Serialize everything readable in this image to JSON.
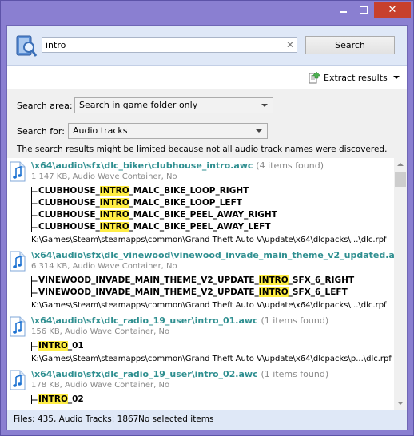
{
  "search": {
    "value": "intro",
    "clear_glyph": "✕",
    "button_label": "Search"
  },
  "toolbar": {
    "extract_label": "Extract results"
  },
  "form": {
    "area_label": "Search area:",
    "area_value": "Search in game folder only",
    "for_label": "Search for:",
    "for_value": "Audio tracks",
    "notice": "The search results might be limited because not all audio track names were discovered."
  },
  "results": [
    {
      "path": "\\x64\\audio\\sfx\\dlc_biker\\clubhouse_intro.awc",
      "count": "(4 items found)",
      "meta": "1 147 KB, Audio Wave Container, No",
      "tracks": [
        {
          "pre": "CLUBHOUSE_",
          "match": "INTRO",
          "post": "_MALC_BIKE_LOOP_RIGHT"
        },
        {
          "pre": "CLUBHOUSE_",
          "match": "INTRO",
          "post": "_MALC_BIKE_LOOP_LEFT"
        },
        {
          "pre": "CLUBHOUSE_",
          "match": "INTRO",
          "post": "_MALC_BIKE_PEEL_AWAY_RIGHT"
        },
        {
          "pre": "CLUBHOUSE_",
          "match": "INTRO",
          "post": "_MALC_BIKE_PEEL_AWAY_LEFT"
        }
      ],
      "location": "K:\\Games\\Steam\\steamapps\\common\\Grand Theft Auto V\\update\\x64\\dlcpacks\\...\\dlc.rpf"
    },
    {
      "path": "\\x64\\audio\\sfx\\dlc_vinewood\\vinewood_invade_main_theme_v2_updated.a",
      "count": "",
      "meta": "6 314 KB, Audio Wave Container, No",
      "tracks": [
        {
          "pre": "VINEWOOD_INVADE_MAIN_THEME_V2_UPDATE_",
          "match": "INTRO",
          "post": "_SFX_6_RIGHT"
        },
        {
          "pre": "VINEWOOD_INVADE_MAIN_THEME_V2_UPDATE_",
          "match": "INTRO",
          "post": "_SFX_6_LEFT"
        }
      ],
      "location": "K:\\Games\\Steam\\steamapps\\common\\Grand Theft Auto V\\update\\x64\\dlcpacks\\...\\dlc.rpf"
    },
    {
      "path": "\\x64\\audio\\sfx\\dlc_radio_19_user\\intro_01.awc",
      "count": "(1 items found)",
      "meta": "156 KB, Audio Wave Container, No",
      "tracks": [
        {
          "pre": "",
          "match": "INTRO",
          "post": "_01"
        }
      ],
      "location": "K:\\Games\\Steam\\steamapps\\common\\Grand Theft Auto V\\update\\x64\\dlcpacks\\p...\\dlc.rpf"
    },
    {
      "path": "\\x64\\audio\\sfx\\dlc_radio_19_user\\intro_02.awc",
      "count": "(1 items found)",
      "meta": "178 KB, Audio Wave Container, No",
      "tracks": [
        {
          "pre": "",
          "match": "INTRO",
          "post": "_02"
        }
      ],
      "location": ""
    }
  ],
  "status": {
    "files": "Files: 435, Audio Tracks: 1867",
    "selection": "No selected items"
  },
  "icons": {
    "app_logo": "magnifier-book-icon",
    "file": "music-note-file-icon",
    "extract": "extract-icon",
    "minimize": "minimize-icon",
    "maximize": "maximize-icon",
    "close": "close-icon"
  },
  "colors": {
    "frame": "#8a7fd1",
    "close": "#c7402d",
    "file_title": "#2f8f90",
    "highlight": "#ffee44",
    "toolbar_bg": "#dfe8f7"
  }
}
